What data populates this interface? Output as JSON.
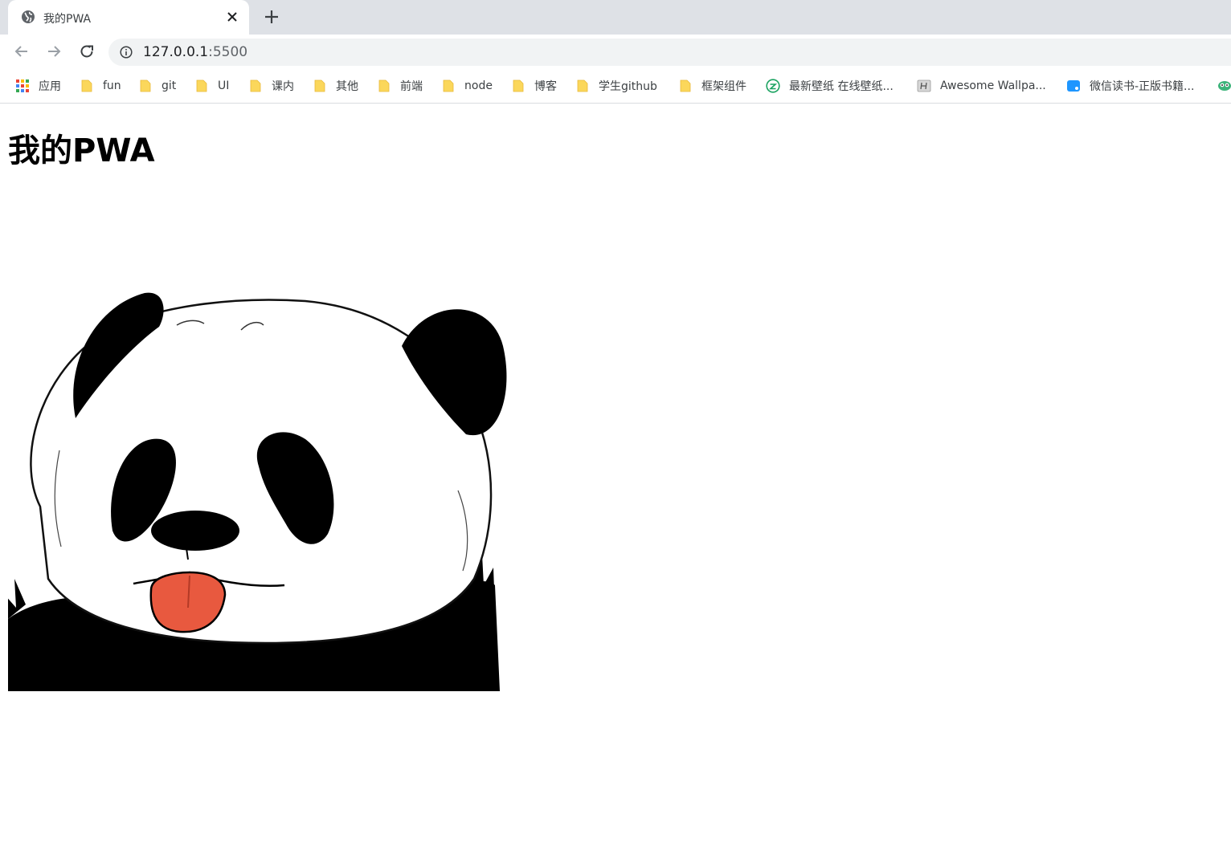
{
  "tab": {
    "title": "我的PWA",
    "favicon": "globe-icon",
    "close_icon": "close-icon",
    "new_tab_icon": "plus-icon"
  },
  "toolbar": {
    "back_icon": "arrow-back-icon",
    "forward_icon": "arrow-forward-icon",
    "reload_icon": "reload-icon",
    "site_info_icon": "info-icon",
    "url_host": "127.0.0.1",
    "url_port": ":5500"
  },
  "bookmarks": [
    {
      "label": "应用",
      "icon": "apps-grid-icon"
    },
    {
      "label": "fun",
      "icon": "folder-icon"
    },
    {
      "label": "git",
      "icon": "folder-icon"
    },
    {
      "label": "UI",
      "icon": "folder-icon"
    },
    {
      "label": "课内",
      "icon": "folder-icon"
    },
    {
      "label": "其他",
      "icon": "folder-icon"
    },
    {
      "label": "前端",
      "icon": "folder-icon"
    },
    {
      "label": "node",
      "icon": "folder-icon"
    },
    {
      "label": "博客",
      "icon": "folder-icon"
    },
    {
      "label": "学生github",
      "icon": "folder-icon"
    },
    {
      "label": "框架组件",
      "icon": "folder-icon"
    },
    {
      "label": "最新壁纸 在线壁纸...",
      "icon": "wallpaper-site-icon"
    },
    {
      "label": "Awesome Wallpa...",
      "icon": "awesome-wallpapers-icon"
    },
    {
      "label": "微信读书-正版书籍...",
      "icon": "weread-icon"
    }
  ],
  "page": {
    "heading": "我的PWA",
    "image": "panda-illustration"
  },
  "colors": {
    "tabstrip": "#dee1e6",
    "omnibox": "#f1f3f4",
    "folder": "#fbd75b",
    "tongue": "#e8593f"
  }
}
